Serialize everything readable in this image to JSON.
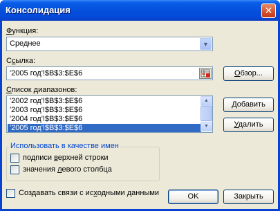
{
  "window": {
    "title": "Консолидация",
    "close_glyph": "✕"
  },
  "function": {
    "label": "Функция:",
    "label_accel": "Ф",
    "label_rest": "ункция:",
    "value": "Среднее",
    "arrow_icon": "chevron-down-icon"
  },
  "reference": {
    "label_pre": "С",
    "label_accel": "с",
    "label_rest": "ылка:",
    "value": "'2005 год'!$B$3:$E$6"
  },
  "browse_button": {
    "label_pre": "",
    "label_accel": "О",
    "label_rest": "бзор..."
  },
  "ranges": {
    "label_accel": "С",
    "label_rest": "писок диапазонов:",
    "items": [
      "'2002 год'!$B$3:$E$6",
      "'2003 год'!$B$3:$E$6",
      "'2004 год'!$B$3:$E$6",
      "'2005 год'!$B$3:$E$6"
    ],
    "selected_index": 3
  },
  "add_button": {
    "label_pre": "",
    "label_accel": "Д",
    "label_rest": "обавить"
  },
  "delete_button": {
    "label_pre": "",
    "label_accel": "У",
    "label_rest": "далить"
  },
  "use_names": {
    "title": "Использовать в качестве имен",
    "top_row": {
      "pre": "подписи ",
      "accel": "в",
      "rest": "ерхней строки",
      "checked": false
    },
    "left_col": {
      "pre": "значения ",
      "accel": "л",
      "rest": "евого столбца",
      "checked": false
    }
  },
  "links": {
    "pre": "Создавать связи с ис",
    "accel": "х",
    "rest": "одными данными",
    "checked": false
  },
  "ok_button": {
    "label": "OK"
  },
  "close_button": {
    "label": "Закрыть"
  },
  "colors": {
    "selection": "#316ac5",
    "title_bar": "#0450dc",
    "group_title": "#0046d5"
  }
}
